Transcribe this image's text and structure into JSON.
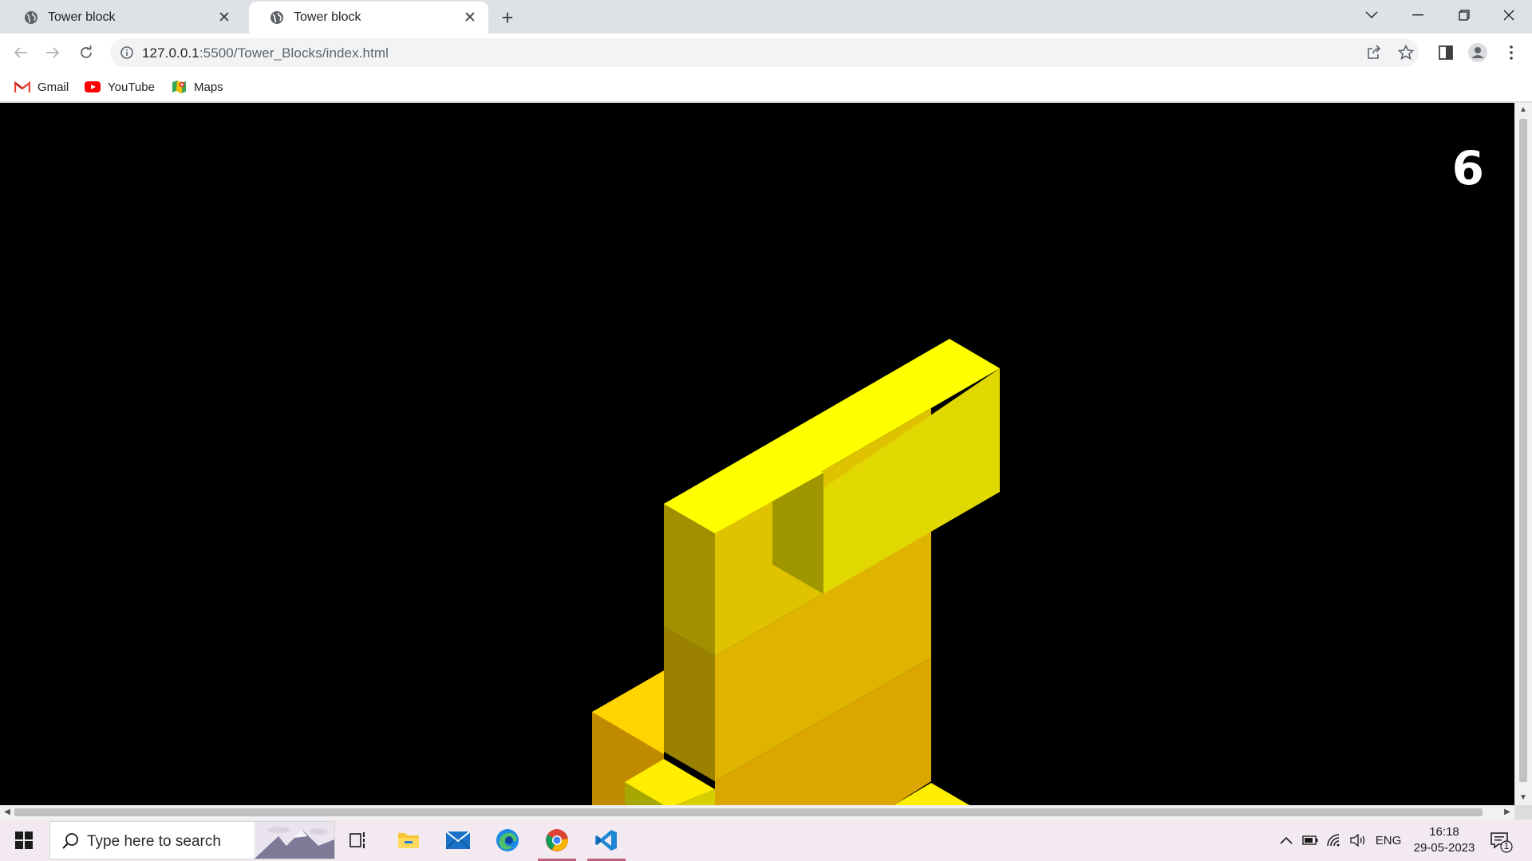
{
  "browser": {
    "tabs": [
      {
        "title": "Tower block",
        "active": false
      },
      {
        "title": "Tower block",
        "active": true
      }
    ],
    "url_host": "127.0.0.1",
    "url_path": ":5500/Tower_Blocks/index.html",
    "bookmarks": [
      {
        "label": "Gmail",
        "icon": "gmail-icon"
      },
      {
        "label": "YouTube",
        "icon": "youtube-icon"
      },
      {
        "label": "Maps",
        "icon": "maps-icon"
      }
    ]
  },
  "game": {
    "score": "6",
    "block_color": "#ffff00",
    "background": "#000000"
  },
  "taskbar": {
    "search_placeholder": "Type here to search",
    "apps": [
      "task-view-icon",
      "file-explorer-icon",
      "mail-icon",
      "edge-icon",
      "chrome-icon",
      "vscode-icon"
    ],
    "language": "ENG",
    "time": "16:18",
    "date": "29-05-2023",
    "notification_count": "1"
  }
}
